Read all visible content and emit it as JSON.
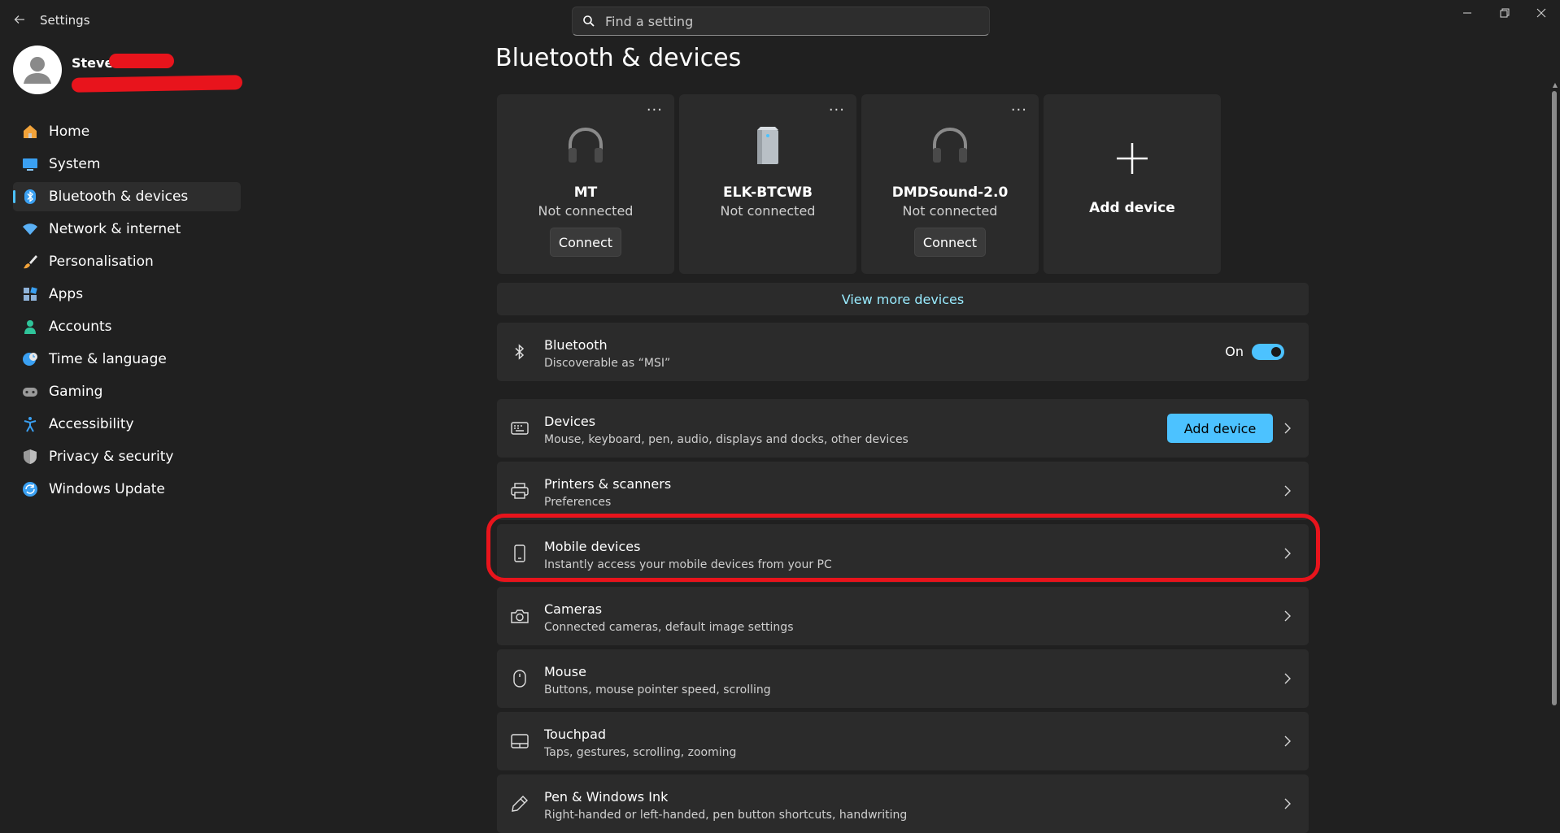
{
  "window": {
    "title": "Settings",
    "search_placeholder": "Find a setting"
  },
  "profile": {
    "name": "Steve"
  },
  "sidebar": {
    "items": [
      {
        "label": "Home",
        "icon": "home-icon",
        "color": "#f2a33a"
      },
      {
        "label": "System",
        "icon": "monitor-icon",
        "color": "#3aa0f2"
      },
      {
        "label": "Bluetooth & devices",
        "icon": "bluetooth-icon",
        "color": "#3aa0f2",
        "active": true
      },
      {
        "label": "Network & internet",
        "icon": "wifi-icon",
        "color": "#5ab0f5"
      },
      {
        "label": "Personalisation",
        "icon": "brush-icon",
        "color": "#f2a33a"
      },
      {
        "label": "Apps",
        "icon": "apps-icon",
        "color": "#8fb3d9"
      },
      {
        "label": "Accounts",
        "icon": "person-icon",
        "color": "#2fc49a"
      },
      {
        "label": "Time & language",
        "icon": "globe-clock-icon",
        "color": "#3aa0f2"
      },
      {
        "label": "Gaming",
        "icon": "gamepad-icon",
        "color": "#9a9a9a"
      },
      {
        "label": "Accessibility",
        "icon": "accessibility-icon",
        "color": "#3aa0f2"
      },
      {
        "label": "Privacy & security",
        "icon": "shield-icon",
        "color": "#9a9a9a"
      },
      {
        "label": "Windows Update",
        "icon": "sync-icon",
        "color": "#3aa0f2"
      }
    ]
  },
  "page": {
    "title": "Bluetooth & devices"
  },
  "device_cards": [
    {
      "name": "MT",
      "status": "Not connected",
      "connect_label": "Connect",
      "icon": "headphones-icon",
      "more": "..."
    },
    {
      "name": "ELK-BTCWB",
      "status": "Not connected",
      "icon": "speaker-tower-icon",
      "more": "..."
    },
    {
      "name": "DMDSound-2.0",
      "status": "Not connected",
      "connect_label": "Connect",
      "icon": "headphones-icon",
      "more": "..."
    }
  ],
  "add_card": {
    "label": "Add device"
  },
  "view_more": {
    "label": "View more devices"
  },
  "bluetooth_row": {
    "title": "Bluetooth",
    "subtitle": "Discoverable as “MSI”",
    "toggle_label": "On",
    "toggle_on": true
  },
  "rows": [
    {
      "title": "Devices",
      "subtitle": "Mouse, keyboard, pen, audio, displays and docks, other devices",
      "icon": "keyboard-icon",
      "button": "Add device"
    },
    {
      "title": "Printers & scanners",
      "subtitle": "Preferences",
      "icon": "printer-icon"
    },
    {
      "title": "Mobile devices",
      "subtitle": "Instantly access your mobile devices from your PC",
      "icon": "phone-icon"
    },
    {
      "title": "Cameras",
      "subtitle": "Connected cameras, default image settings",
      "icon": "camera-icon"
    },
    {
      "title": "Mouse",
      "subtitle": "Buttons, mouse pointer speed, scrolling",
      "icon": "mouse-icon"
    },
    {
      "title": "Touchpad",
      "subtitle": "Taps, gestures, scrolling, zooming",
      "icon": "touchpad-icon"
    },
    {
      "title": "Pen & Windows Ink",
      "subtitle": "Right-handed or left-handed, pen button shortcuts, handwriting",
      "icon": "pen-icon"
    }
  ],
  "colors": {
    "accent": "#4cc2ff",
    "background": "#202020",
    "card": "#2b2b2b",
    "annotation": "#e8141c"
  }
}
